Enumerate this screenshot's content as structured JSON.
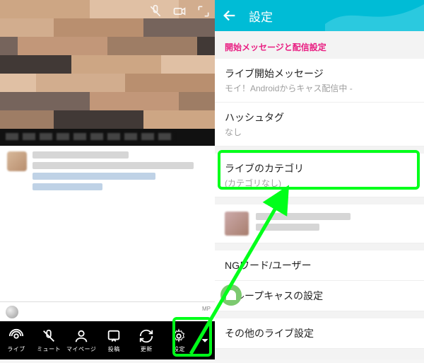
{
  "left": {
    "video_top_icons": [
      "mic-mute-icon",
      "camera-icon",
      "expand-icon"
    ],
    "tabbar": [
      {
        "icon": "live-icon",
        "label": "ライブ"
      },
      {
        "icon": "mute-icon",
        "label": "ミュート"
      },
      {
        "icon": "mypage-icon",
        "label": "マイページ"
      },
      {
        "icon": "post-icon",
        "label": "投稿"
      },
      {
        "icon": "refresh-icon",
        "label": "更新"
      },
      {
        "icon": "settings-icon",
        "label": "設定"
      },
      {
        "icon": "more-icon",
        "label": ""
      }
    ],
    "mp_label": "MP"
  },
  "right": {
    "header_title": "設定",
    "section_title": "開始メッセージと配信設定",
    "rows": [
      {
        "title": "ライブ開始メッセージ",
        "sub": "モイ！Androidからキャス配信中 -"
      },
      {
        "title": "ハッシュタグ",
        "sub": "なし"
      },
      {
        "title": "ライブのカテゴリ",
        "sub": "(カテゴリなし)"
      },
      {
        "title": "NGワード/ユーザー",
        "sub": ""
      },
      {
        "title": "グループキャスの設定",
        "sub": ""
      },
      {
        "title": "その他のライブ設定",
        "sub": ""
      }
    ]
  },
  "colors": {
    "accent": "#00bcd6",
    "highlight": "#00ff1a",
    "heading": "#e91e82"
  }
}
